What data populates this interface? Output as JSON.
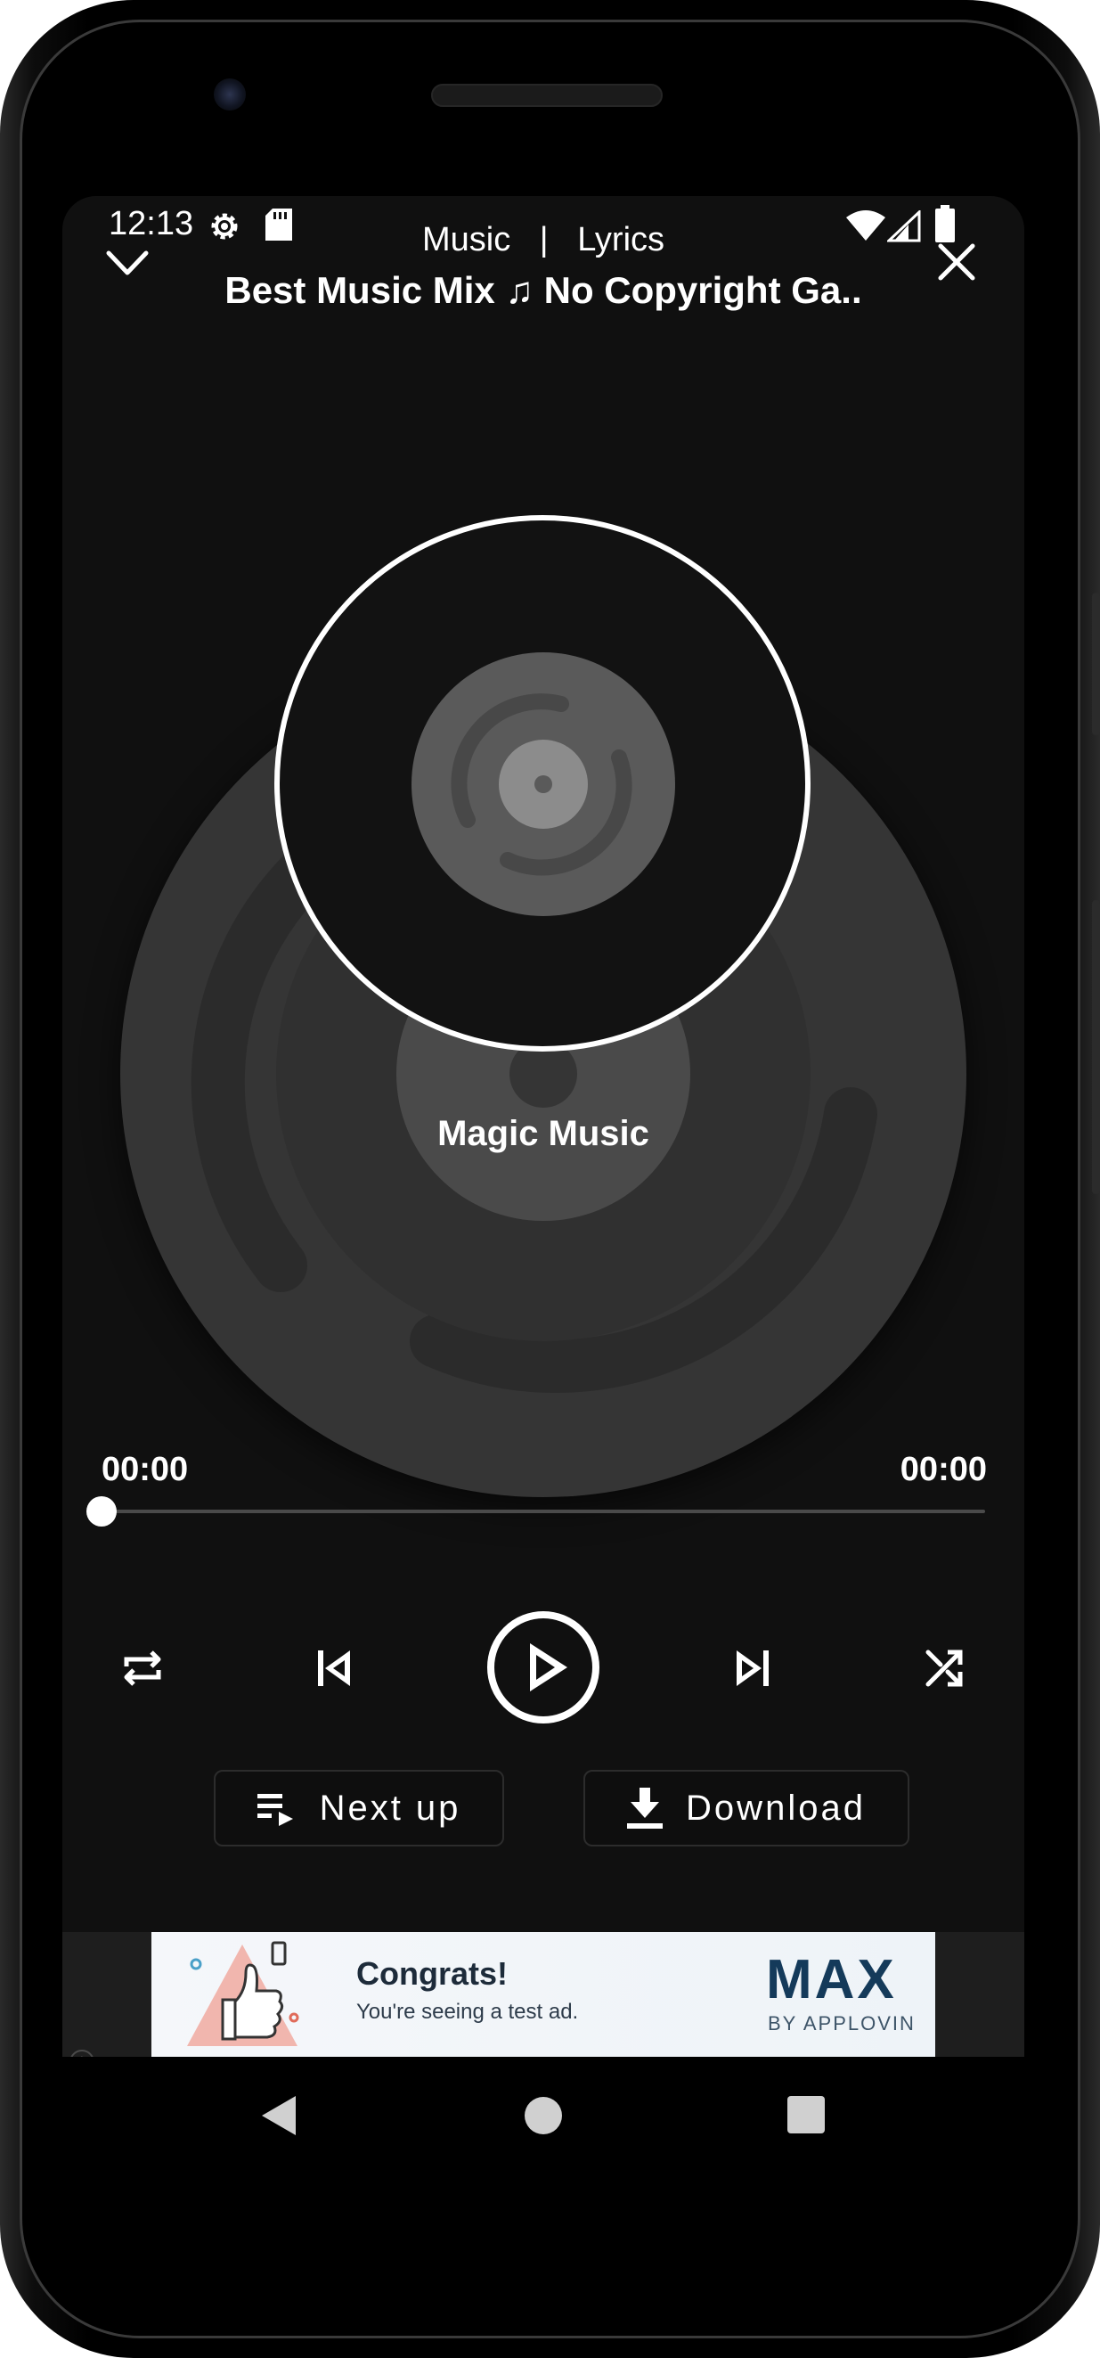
{
  "status_bar": {
    "time": "12:13",
    "left_icons": [
      "gear-icon",
      "sd-card-icon"
    ],
    "right_icons": [
      "wifi-icon",
      "cell-signal-icon",
      "battery-icon"
    ]
  },
  "header": {
    "tab_music": "Music",
    "separator": "|",
    "tab_lyrics": "Lyrics",
    "title": "Best Music Mix ♫ No Copyright Ga.."
  },
  "artwork": {
    "brand": "Magic Music"
  },
  "player": {
    "current_time": "00:00",
    "total_time": "00:00",
    "progress": 0,
    "controls": [
      "repeat-icon",
      "skip-previous-icon",
      "play-icon",
      "skip-next-icon",
      "shuffle-icon"
    ]
  },
  "actions": {
    "next_up": "Next up",
    "download": "Download"
  },
  "ad": {
    "title": "Congrats!",
    "subtitle": "You're seeing a test ad.",
    "brand": "MAX",
    "brand_by": "BY APPLOVIN",
    "info": "i"
  },
  "colors": {
    "background": "#101010",
    "text": "#ffffff",
    "disc": "#353535",
    "seek_track": "#4a4a4a"
  }
}
